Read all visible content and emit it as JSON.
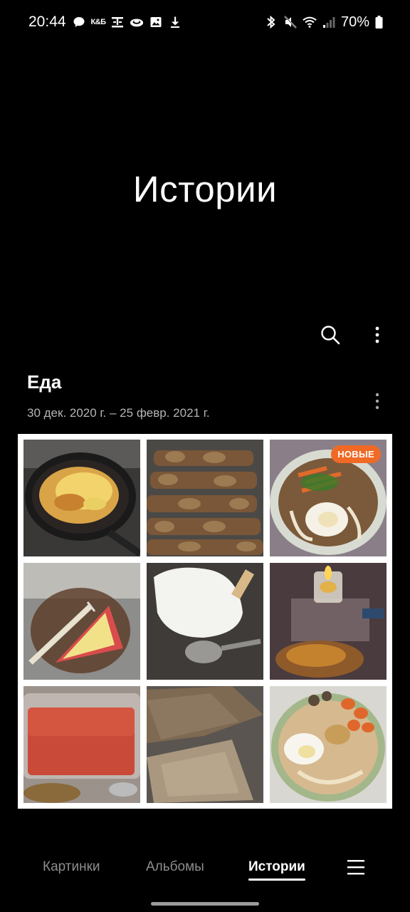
{
  "status_bar": {
    "time": "20:44",
    "left_icons": [
      "chat-bubble-icon",
      "kb-app-icon",
      "trophy-icon",
      "cloud-icon",
      "image-icon",
      "download-icon"
    ],
    "kb_label": "К&Б",
    "right_icons": [
      "bluetooth-icon",
      "mute-icon",
      "wifi-icon",
      "signal-icon",
      "battery-icon"
    ],
    "battery_percent": "70%"
  },
  "header": {
    "title": "Истории",
    "actions": [
      "search-icon",
      "more-vert-icon"
    ]
  },
  "story": {
    "title": "Еда",
    "dates": "30 дек. 2020 г. – 25 февр. 2021 г.",
    "badge": "НОВЫЕ",
    "photos": [
      "fried-pasta-with-cheese",
      "grilled-shashlik",
      "noodle-soup-with-egg",
      "cheesy-pizza-slice",
      "ice-cream-and-spoon",
      "candle-and-dessert",
      "red-sauce-container",
      "flatbread-pancakes",
      "ramen-bowl"
    ]
  },
  "bottom_nav": {
    "items": [
      {
        "label": "Картинки"
      },
      {
        "label": "Альбомы"
      },
      {
        "label": "Истории"
      }
    ],
    "active_index": 2,
    "menu_icon": "hamburger-icon"
  },
  "colors": {
    "background": "#000000",
    "badge": "#f06a25",
    "inactive_nav": "#8d8d8d",
    "secondary_text": "#b5b5b5"
  }
}
